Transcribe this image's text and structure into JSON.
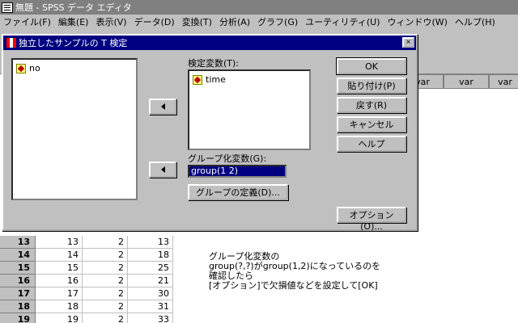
{
  "window": {
    "title": "無題 - SPSS データ エディタ",
    "menu": [
      "ファイル(F)",
      "編集(E)",
      "表示(V)",
      "データ(D)",
      "変換(T)",
      "分析(A)",
      "グラフ(G)",
      "ユーティリティ(U)",
      "ウィンドウ(W)",
      "ヘルプ(H)"
    ]
  },
  "grid": {
    "col_headers": [
      "var",
      "var",
      "var"
    ],
    "rows": [
      {
        "num": "13",
        "c1": "13",
        "c2": "2",
        "c3": "13"
      },
      {
        "num": "14",
        "c1": "14",
        "c2": "2",
        "c3": "18"
      },
      {
        "num": "15",
        "c1": "15",
        "c2": "2",
        "c3": "25"
      },
      {
        "num": "16",
        "c1": "16",
        "c2": "2",
        "c3": "21"
      },
      {
        "num": "17",
        "c1": "17",
        "c2": "2",
        "c3": "30"
      },
      {
        "num": "18",
        "c1": "18",
        "c2": "2",
        "c3": "31"
      },
      {
        "num": "19",
        "c1": "19",
        "c2": "2",
        "c3": "33"
      }
    ]
  },
  "note": {
    "lines": [
      "グループ化変数の",
      "group(?,?)がgroup(1,2)になっているのを",
      "確認したら",
      "[オプション]で欠損値などを設定して[OK]"
    ]
  },
  "dialog": {
    "title": "独立したサンプルの T 検定",
    "close": "×",
    "source_vars": [
      "no"
    ],
    "test_label": "検定変数(T):",
    "test_vars": [
      "time"
    ],
    "group_label": "グループ化変数(G):",
    "group_value": "group(1 2)",
    "define_groups": "グループの定義(D)...",
    "buttons": {
      "ok": "OK",
      "paste": "貼り付け(P)",
      "reset": "戻す(R)",
      "cancel": "キャンセル",
      "help": "ヘルプ",
      "options": "オプション(O)..."
    }
  }
}
